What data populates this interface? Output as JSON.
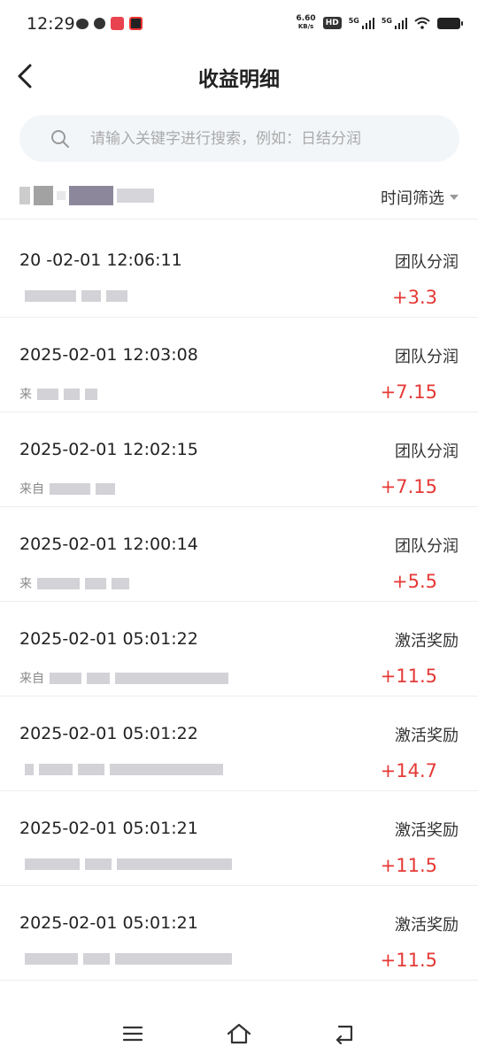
{
  "status_bar": {
    "time": "12:29",
    "net_speed_value": "6.60",
    "net_speed_unit": "KB/s",
    "hd_label": "HD",
    "signal1_label": "5G",
    "signal2_label": "5G"
  },
  "header": {
    "title": "收益明细"
  },
  "search": {
    "placeholder": "请输入关键字进行搜索，例如：日结分润"
  },
  "filter": {
    "label": "时间筛选"
  },
  "records": [
    {
      "time": "20  -02-01 12:06:11",
      "type": "团队分润",
      "amount": "+3.3",
      "source_prefix": ""
    },
    {
      "time": "2025-02-01 12:03:08",
      "type": "团队分润",
      "amount": "+7.15",
      "source_prefix": "来"
    },
    {
      "time": "2025-02-01 12:02:15",
      "type": "团队分润",
      "amount": "+7.15",
      "source_prefix": "来自"
    },
    {
      "time": "2025-02-01 12:00:14",
      "type": "团队分润",
      "amount": "+5.5",
      "source_prefix": "来"
    },
    {
      "time": "2025-02-01 05:01:22",
      "type": "激活奖励",
      "amount": "+11.5",
      "source_prefix": "来自"
    },
    {
      "time": "2025-02-01 05:01:22",
      "type": "激活奖励",
      "amount": "+14.7",
      "source_prefix": ""
    },
    {
      "time": "2025-02-01 05:01:21",
      "type": "激活奖励",
      "amount": "+11.5",
      "source_prefix": ""
    },
    {
      "time": "2025-02-01 05:01:21",
      "type": "激活奖励",
      "amount": "+11.5",
      "source_prefix": ""
    }
  ],
  "colors": {
    "amount": "#e53935",
    "search_bg": "#f3f6f9",
    "divider": "#eeeeee"
  }
}
